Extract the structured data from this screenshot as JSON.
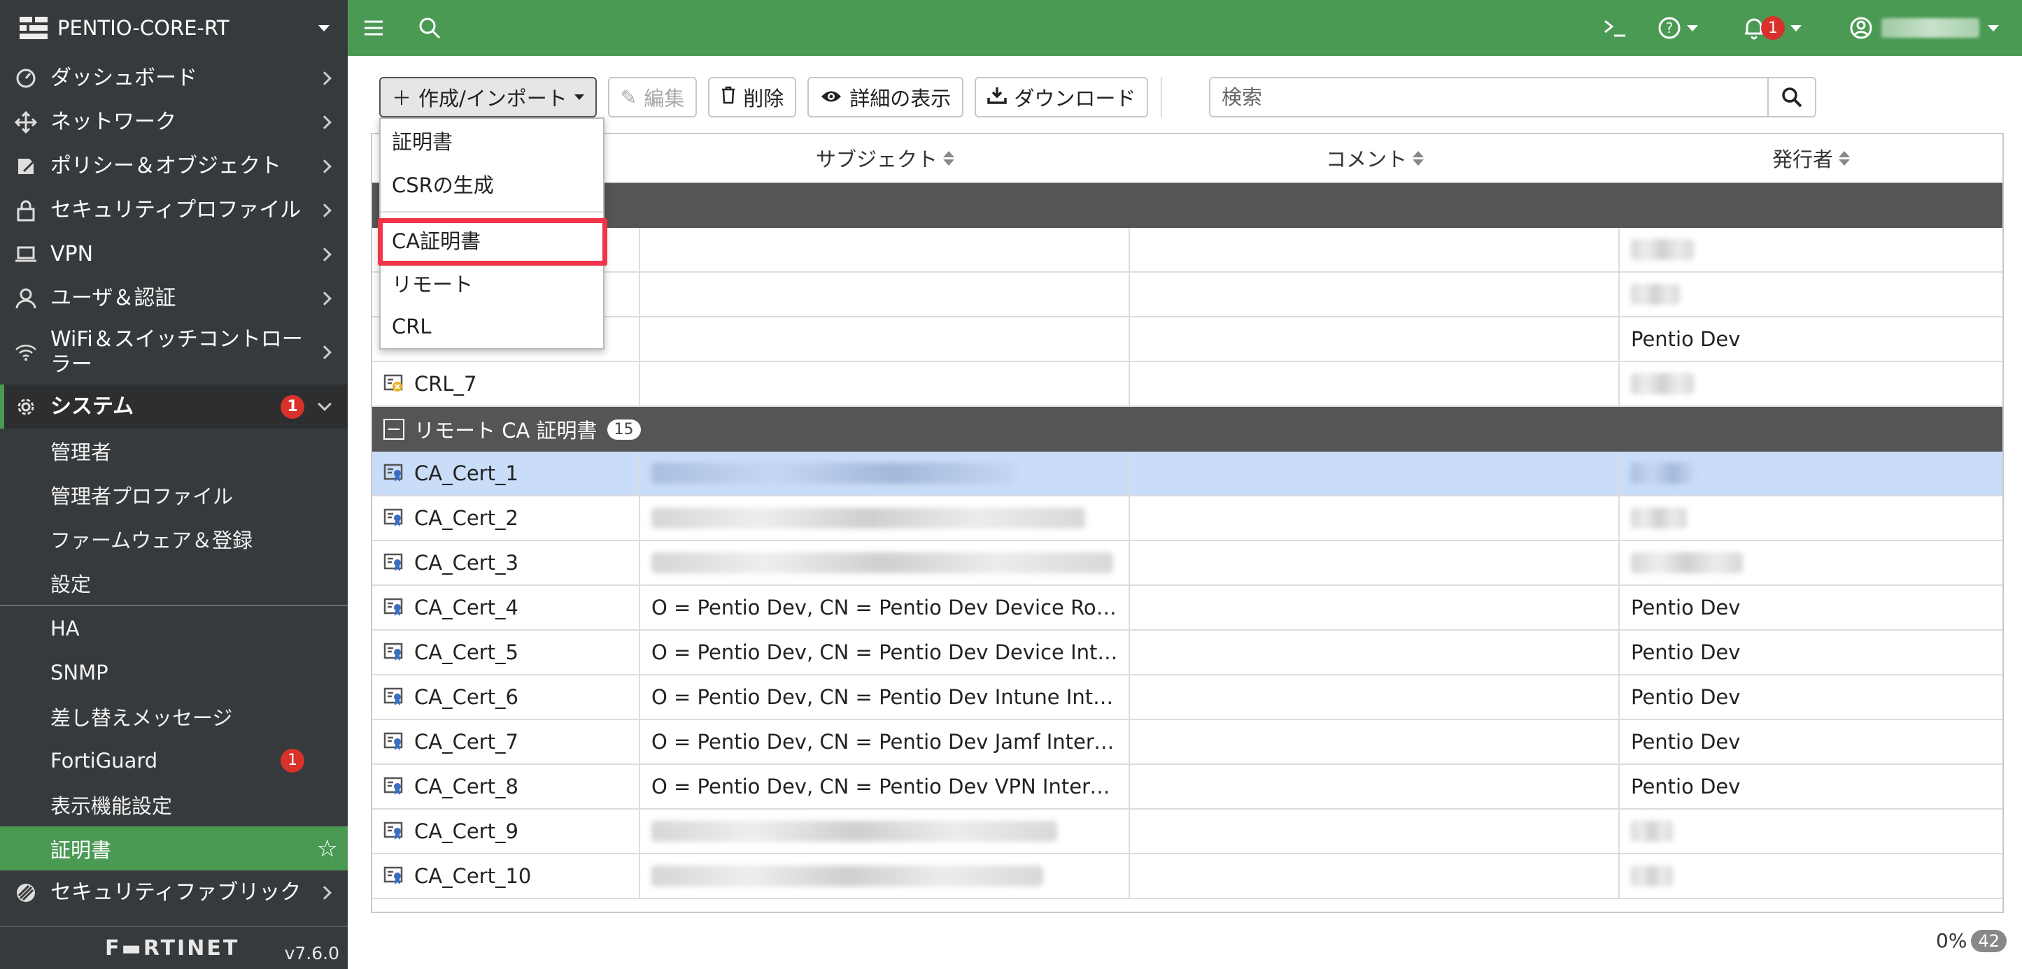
{
  "sidebar": {
    "hostname": "PENTIO-CORE-RT",
    "items": [
      {
        "label": "ダッシュボード",
        "icon": "dashboard-icon"
      },
      {
        "label": "ネットワーク",
        "icon": "network-icon"
      },
      {
        "label": "ポリシー＆オブジェクト",
        "icon": "policy-icon"
      },
      {
        "label": "セキュリティプロファイル",
        "icon": "lock-icon"
      },
      {
        "label": "VPN",
        "icon": "laptop-icon"
      },
      {
        "label": "ユーザ＆認証",
        "icon": "user-icon"
      },
      {
        "label": "WiFi＆スイッチコントローラー",
        "icon": "wifi-icon"
      }
    ],
    "system": {
      "label": "システム",
      "badge": "1"
    },
    "system_sub_a": [
      {
        "label": "管理者"
      },
      {
        "label": "管理者プロファイル"
      },
      {
        "label": "ファームウェア＆登録"
      },
      {
        "label": "設定"
      }
    ],
    "system_sub_b": [
      {
        "label": "HA"
      },
      {
        "label": "SNMP"
      },
      {
        "label": "差し替えメッセージ"
      },
      {
        "label": "FortiGuard",
        "badge": "1"
      },
      {
        "label": "表示機能設定"
      },
      {
        "label": "証明書"
      }
    ],
    "fabric": {
      "label": "セキュリティファブリック"
    },
    "brand": "F▬RTINET",
    "version": "v7.6.0"
  },
  "topbar": {
    "notification_count": "1",
    "colors": {
      "accent": "#4b9a54"
    }
  },
  "toolbar": {
    "create": "作成/インポート",
    "edit": "編集",
    "delete": "削除",
    "details": "詳細の表示",
    "download": "ダウンロード"
  },
  "search": {
    "placeholder": "検索"
  },
  "dropdown": {
    "items": [
      "証明書",
      "CSRの生成",
      "CA証明書",
      "リモート",
      "CRL"
    ]
  },
  "table": {
    "headers": {
      "subject": "サブジェクト",
      "comment": "コメント",
      "issuer": "発行者"
    },
    "top_rows": [
      {
        "name": "",
        "subject": "",
        "issuer": ""
      },
      {
        "name": "",
        "subject": "",
        "issuer": ""
      },
      {
        "name": "",
        "subject": "",
        "issuer": "Pentio Dev"
      },
      {
        "name": "CRL_7",
        "subject": "",
        "issuer": ""
      }
    ],
    "group": {
      "label": "リモート CA 証明書",
      "count": "15"
    },
    "rows": [
      {
        "name": "CA_Cert_1",
        "subject": "",
        "issuer": ""
      },
      {
        "name": "CA_Cert_2",
        "subject": "",
        "issuer": ""
      },
      {
        "name": "CA_Cert_3",
        "subject": "",
        "issuer": ""
      },
      {
        "name": "CA_Cert_4",
        "subject": "O = Pentio Dev, CN = Pentio Dev Device Root CA",
        "issuer": "Pentio Dev"
      },
      {
        "name": "CA_Cert_5",
        "subject": "O = Pentio Dev, CN = Pentio Dev Device Interme…",
        "issuer": "Pentio Dev"
      },
      {
        "name": "CA_Cert_6",
        "subject": "O = Pentio Dev, CN = Pentio Dev Intune Intermed…",
        "issuer": "Pentio Dev"
      },
      {
        "name": "CA_Cert_7",
        "subject": "O = Pentio Dev, CN = Pentio Dev Jamf Intermedia…",
        "issuer": "Pentio Dev"
      },
      {
        "name": "CA_Cert_8",
        "subject": "O = Pentio Dev, CN = Pentio Dev VPN Intermedia…",
        "issuer": "Pentio Dev"
      },
      {
        "name": "CA_Cert_9",
        "subject": "",
        "issuer": ""
      },
      {
        "name": "CA_Cert_10",
        "subject": "",
        "issuer": ""
      }
    ]
  },
  "status": {
    "percent": "0%",
    "total": "42"
  }
}
